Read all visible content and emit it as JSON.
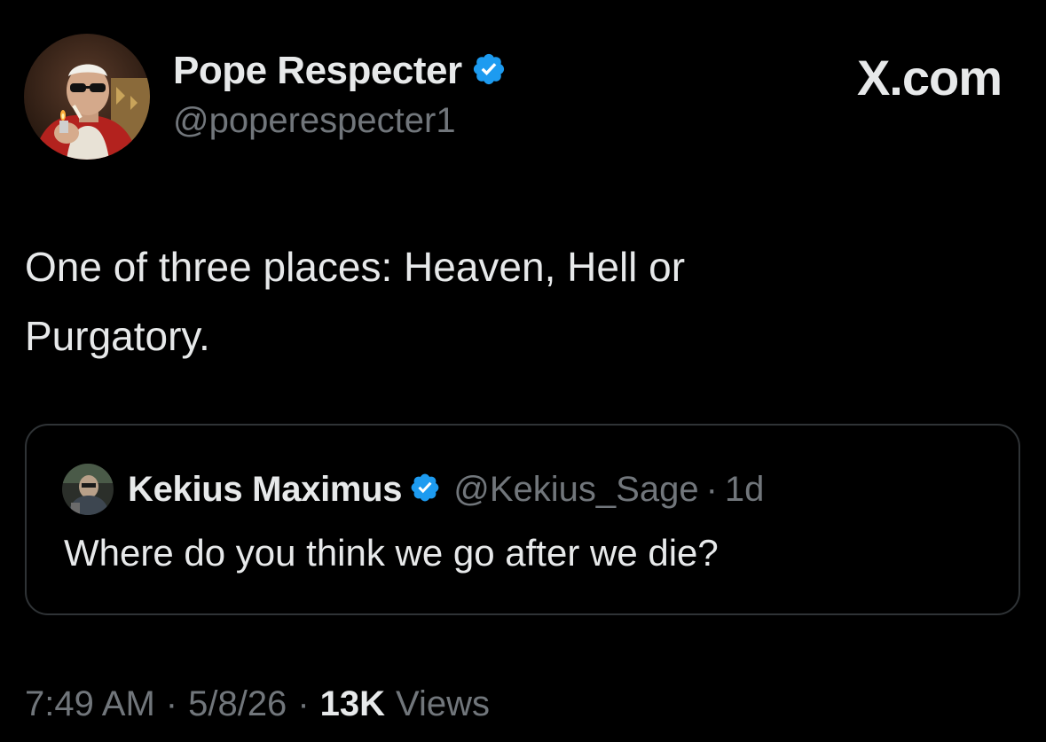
{
  "tweet": {
    "author": {
      "display_name": "Pope Respecter",
      "handle": "@poperespecter1",
      "verified": true,
      "avatar_icon": "avatar-photo"
    },
    "brand": "X.com",
    "text_line1": "One of three places: Heaven, Hell or",
    "text_line2": "Purgatory.",
    "quoted": {
      "display_name": "Kekius Maximus",
      "handle": "@Kekius_Sage",
      "separator": "·",
      "time": "1d",
      "verified": true,
      "text": "Where do you think we go after we die?"
    },
    "meta": {
      "time": "7:49 AM",
      "sep1": "·",
      "date": "5/8/26",
      "sep2": "·",
      "views_count": "13K",
      "views_label": "Views"
    }
  },
  "colors": {
    "background": "#000000",
    "primary_text": "#e7e9ea",
    "secondary_text": "#71767b",
    "verified_blue": "#1d9bf0",
    "card_border": "#2f3336"
  }
}
